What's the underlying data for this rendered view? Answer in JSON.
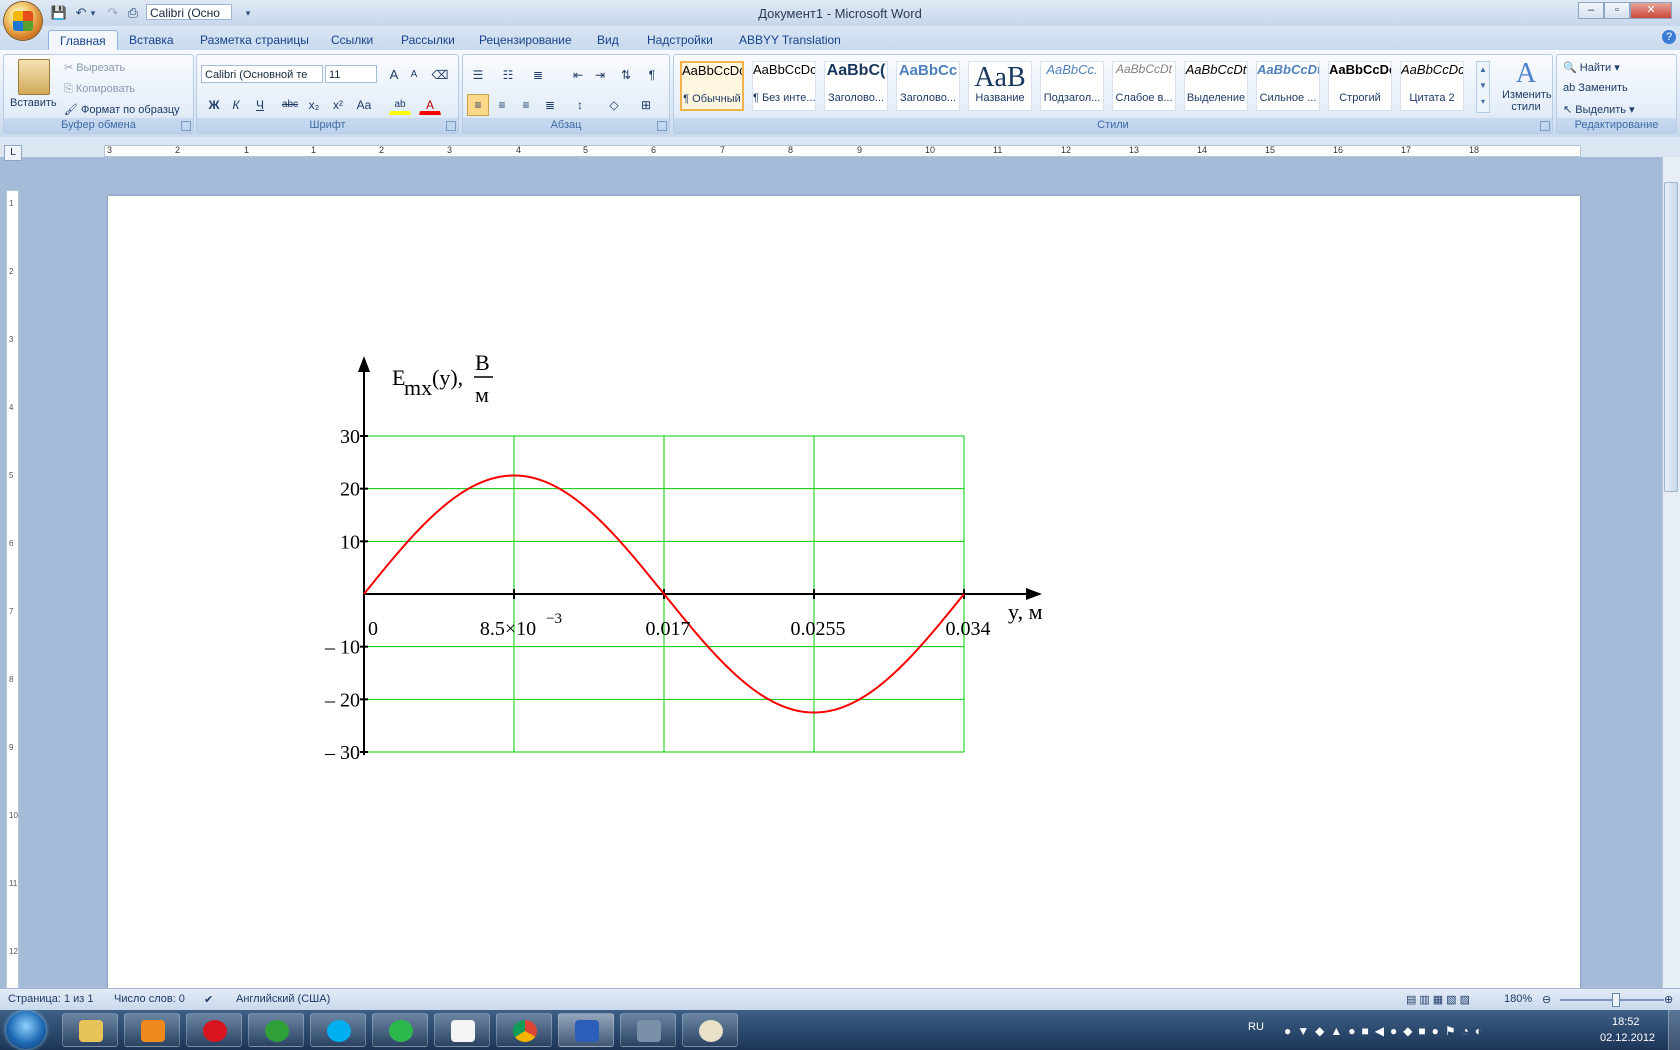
{
  "titlebar": {
    "window_title": "Документ1 - Microsoft Word",
    "quick_font": "Calibri (Осно",
    "controls": {
      "minimize": "–",
      "maximize": "▫",
      "close": "✕"
    }
  },
  "tabs": [
    "Главная",
    "Вставка",
    "Разметка страницы",
    "Ссылки",
    "Рассылки",
    "Рецензирование",
    "Вид",
    "Надстройки",
    "ABBYY Translation"
  ],
  "ribbon": {
    "clipboard": {
      "paste": "Вставить",
      "cut": "Вырезать",
      "copy": "Копировать",
      "format_painter": "Формат по образцу",
      "label": "Буфер обмена"
    },
    "font": {
      "font_name": "Calibri (Основной те",
      "font_size": "11",
      "grow": "A",
      "shrink": "A",
      "bold": "Ж",
      "italic": "К",
      "underline": "Ч",
      "strike": "abc",
      "subscript": "x₂",
      "superscript": "x²",
      "change_case": "Aa",
      "highlight": "ab",
      "font_color": "A",
      "label": "Шрифт"
    },
    "paragraph": {
      "label": "Абзац"
    },
    "styles": {
      "items": [
        {
          "sample": "AaBbCcDc",
          "name": "¶ Обычный"
        },
        {
          "sample": "AaBbCcDc",
          "name": "¶ Без инте..."
        },
        {
          "sample": "AaBbC(",
          "name": "Заголово..."
        },
        {
          "sample": "AaBbCc",
          "name": "Заголово..."
        },
        {
          "sample": "AaB",
          "name": "Название"
        },
        {
          "sample": "AaBbCc.",
          "name": "Подзагол..."
        },
        {
          "sample": "AaBbCcDt",
          "name": "Слабое в..."
        },
        {
          "sample": "AaBbCcDt",
          "name": "Выделение"
        },
        {
          "sample": "AaBbCcDt",
          "name": "Сильное ..."
        },
        {
          "sample": "AaBbCcDc",
          "name": "Строгий"
        },
        {
          "sample": "AaBbCcDc",
          "name": "Цитата 2"
        }
      ],
      "change_styles_line1": "Изменить",
      "change_styles_line2": "стили",
      "label": "Стили"
    },
    "editing": {
      "find": "Найти",
      "replace": "Заменить",
      "select": "Выделить",
      "label": "Редактирование"
    }
  },
  "ruler": {
    "marks": [
      "3",
      "2",
      "1",
      "1",
      "2",
      "3",
      "4",
      "5",
      "6",
      "7",
      "8",
      "9",
      "10",
      "11",
      "12",
      "13",
      "14",
      "15",
      "16",
      "17",
      "18"
    ]
  },
  "chart_data": {
    "type": "line",
    "title": "",
    "ylabel_main": "E",
    "ylabel_sub": "mx",
    "ylabel_rest": "(y),",
    "ylabel_unit_num": "В",
    "ylabel_unit_den": "м",
    "xlabel": "y, м",
    "xlim": [
      0,
      0.034
    ],
    "ylim": [
      -30,
      30
    ],
    "grid": true,
    "x_ticks": [
      "0",
      "8.5×10",
      "0.017",
      "0.0255",
      "0.034"
    ],
    "x_tick_exp": "−3",
    "x_tick_values": [
      0,
      0.0085,
      0.017,
      0.0255,
      0.034
    ],
    "y_ticks": [
      "30",
      "20",
      "10",
      "– 10",
      "– 20",
      "– 30"
    ],
    "y_tick_values": [
      30,
      20,
      10,
      -10,
      -20,
      -30
    ],
    "series": [
      {
        "function": "A*sin(2*pi*y/0.034)",
        "amplitude": 22.5,
        "period": 0.034,
        "color": "#ff0000"
      }
    ],
    "grid_color": "#00cc00",
    "axis_color": "#000000"
  },
  "status": {
    "page": "Страница: 1 из 1",
    "words": "Число слов: 0",
    "language": "Английский (США)",
    "zoom": "180%"
  },
  "taskbar": {
    "lang": "RU",
    "time": "18:52",
    "date": "02.12.2012",
    "apps": [
      "explorer",
      "media-player",
      "opera",
      "utorrent",
      "skype",
      "agent",
      "notepad",
      "chrome",
      "word",
      "mathcad",
      "paint"
    ]
  }
}
